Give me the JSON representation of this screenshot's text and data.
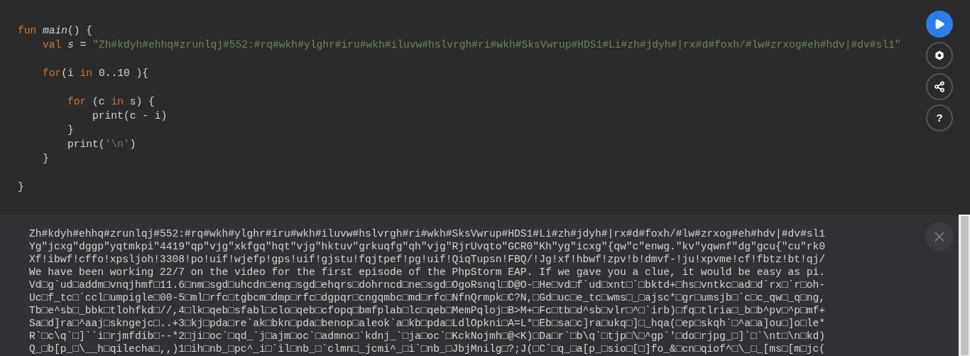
{
  "editor": {
    "lines": [
      {
        "kind": "code",
        "tokens": [
          {
            "text": "fun",
            "kind": "keyword"
          },
          {
            "text": " main",
            "kind": "function"
          },
          {
            "text": "() {",
            "kind": "plain"
          }
        ]
      },
      {
        "kind": "code",
        "tokens": [
          {
            "text": "    val",
            "kind": "keyword"
          },
          {
            "text": " s",
            "kind": "variable"
          },
          {
            "text": " = ",
            "kind": "plain"
          },
          {
            "text": "\"Zh#kdyh#ehhq#zrunlqj#552:#rq#wkh#ylghr#iru#wkh#iluvw#hslvrgh#ri#wkh#SksVwrup#HDS1#Li#zh#jdyh#|rx#d#foxh/#lw#zrxog#eh#hdv|#dv#sl1\"",
            "kind": "string"
          }
        ]
      },
      {
        "kind": "blank"
      },
      {
        "kind": "code",
        "tokens": [
          {
            "text": "    for",
            "kind": "keyword"
          },
          {
            "text": "(i ",
            "kind": "plain"
          },
          {
            "text": "in",
            "kind": "keyword"
          },
          {
            "text": " 0..10 ){",
            "kind": "plain"
          }
        ]
      },
      {
        "kind": "blank"
      },
      {
        "kind": "code",
        "tokens": [
          {
            "text": "        for",
            "kind": "keyword"
          },
          {
            "text": " (c ",
            "kind": "plain"
          },
          {
            "text": "in",
            "kind": "keyword"
          },
          {
            "text": " s) {",
            "kind": "plain"
          }
        ]
      },
      {
        "kind": "code",
        "tokens": [
          {
            "text": "            print(c - i)",
            "kind": "plain"
          }
        ]
      },
      {
        "kind": "code",
        "tokens": [
          {
            "text": "        }",
            "kind": "plain"
          }
        ]
      },
      {
        "kind": "code",
        "tokens": [
          {
            "text": "        print(",
            "kind": "plain"
          },
          {
            "text": "'\\n'",
            "kind": "string"
          },
          {
            "text": ")",
            "kind": "plain"
          }
        ]
      },
      {
        "kind": "code",
        "tokens": [
          {
            "text": "    }",
            "kind": "plain"
          }
        ]
      },
      {
        "kind": "blank"
      },
      {
        "kind": "code",
        "tokens": [
          {
            "text": "}",
            "kind": "plain"
          }
        ]
      }
    ]
  },
  "toolbar": [
    {
      "kind": "run"
    },
    {
      "kind": "settings"
    },
    {
      "kind": "share"
    },
    {
      "kind": "help",
      "label": "?"
    }
  ],
  "output": {
    "lines": [
      "Zh#kdyh#ehhq#zrunlqj#552:#rq#wkh#ylghr#iru#wkh#iluvw#hslvrgh#ri#wkh#SksVwrup#HDS1#Li#zh#jdyh#|rx#d#foxh/#lw#zrxog#eh#hdv|#dv#sl1",
      "Yg\"jcxg\"dggp\"yqtmkpi\"4419\"qp\"vjg\"xkfgq\"hqt\"vjg\"hktuv\"grkuqfg\"qh\"vjg\"RjrUvqto\"GCR0\"Kh\"yg\"icxg\"{qw\"c\"enwg.\"kv\"yqwnf\"dg\"gcu{\"cu\"rk0",
      "Xf!ibwf!cffo!xpsljoh!3308!po!uif!wjefp!gps!uif!gjstu!fqjtpef!pg!uif!QiqTupsn!FBQ/!Jg!xf!hbwf!zpv!b!dmvf-!ju!xpvme!cf!fbtz!bt!qj/",
      "We have been working 22/7 on the video for the first episode of the PhpStorm EAP. If we gave you a clue, it would be easy as pi.",
      "Vd□g`ud□addm□vnqjhmf□11.6□nm□sgd□uhcdn□enq□sgd□ehqrs□dohrncd□ne□sgd□OgoRsnql□D@O-□He□vd□f`ud□xnt□`□bktd+□hs□vntkc□ad□d`rx□`r□oh-",
      "Uc□f_tc□`ccl□umpigle□00-5□ml□rfc□tgbcm□dmp□rfc□dgpqr□cngqmbc□md□rfc□NfnQrmpk□C?N,□Gd□uc□e_tc□wms□_□ajsc*□gr□umsjb□`c□c_qw□_q□ng,",
      "Tb□e^sb□_bbk□tlohfkd□//,4□lk□qeb□sfabl□clo□qeb□cfopq□bmfplab□lc□qeb□MemPqloj□B>M+□Fc□tb□d^sb□vlr□^□`irb)□fq□tlria□_b□b^pv□^p□mf+",
      "Sa□d]ra□^aaj□skngejc□..+3□kj□pda□re`ak□bkn□pda□benop□aleok`a□kb□pda□LdlOpkni□A=L*□Eb□sa□c]ra□ukq□]□_hqa(□ep□skqh`□^a□a]ou□]o□le*",
      "R`□c\\q`□]``i□rjmfdib□--*2□ji□oc`□qd_`j□ajm□oc`□admno□`kdnj_`□ja□oc`□KckNojmh□@<K)□Da□r`□b\\q`□tjp□\\□^gp`'□do□rjpg_□]`□`\\nt□\\n□kd)",
      "Q_□b[p_□\\__h□qilecha□,,)1□ih□nb_□pc^_i□`il□nb_□`clmn□_jcmi^_□i`□nb_□JbjMnilg□?;J(□C`□q_□a[p_□sio□[□]fo_&□cn□qiof^□\\_□_[ms□[m□jc("
    ]
  }
}
